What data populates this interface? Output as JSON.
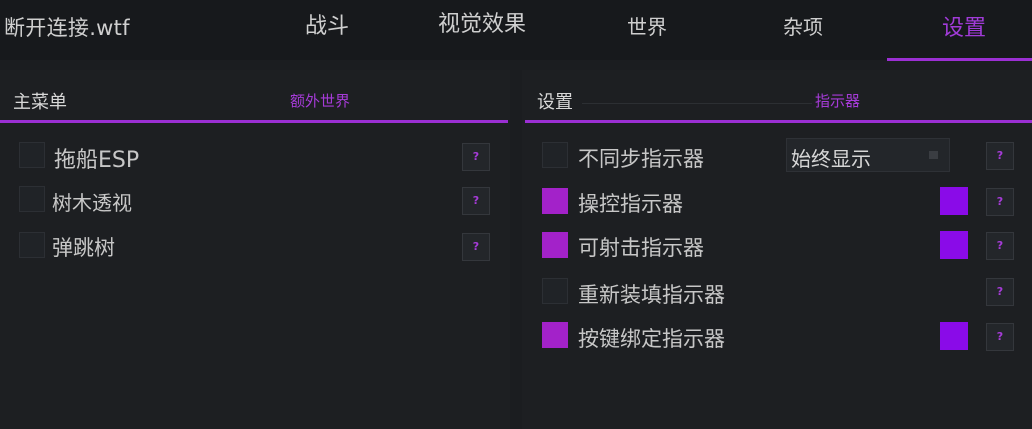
{
  "app": {
    "title": "断开连接.wtf"
  },
  "tabs": [
    {
      "label": "战斗"
    },
    {
      "label": "视觉效果"
    },
    {
      "label": "世界"
    },
    {
      "label": "杂项"
    },
    {
      "label": "设置",
      "active": true
    }
  ],
  "left_panel": {
    "title": "主菜单",
    "subtab": "额外世界",
    "items": [
      {
        "label": "拖船ESP",
        "checked": false,
        "help": "?"
      },
      {
        "label": "树木透视",
        "checked": false,
        "help": "?"
      },
      {
        "label": "弹跳树",
        "checked": false,
        "help": "?"
      }
    ]
  },
  "right_panel": {
    "title": "设置",
    "subtab": "指示器",
    "items": [
      {
        "label": "不同步指示器",
        "checked": false,
        "dropdown": "始终显示",
        "help": "?"
      },
      {
        "label": "操控指示器",
        "checked": true,
        "color": "#8a0be8",
        "help": "?"
      },
      {
        "label": "可射击指示器",
        "checked": true,
        "color": "#8a0be8",
        "help": "?"
      },
      {
        "label": "重新装填指示器",
        "checked": false,
        "help": "?"
      },
      {
        "label": "按键绑定指示器",
        "checked": true,
        "color": "#8a0be8",
        "help": "?"
      }
    ]
  },
  "colors": {
    "accent": "#9b2fd3",
    "checkbox_on": "#a322c9",
    "swatch": "#8a0be8"
  }
}
